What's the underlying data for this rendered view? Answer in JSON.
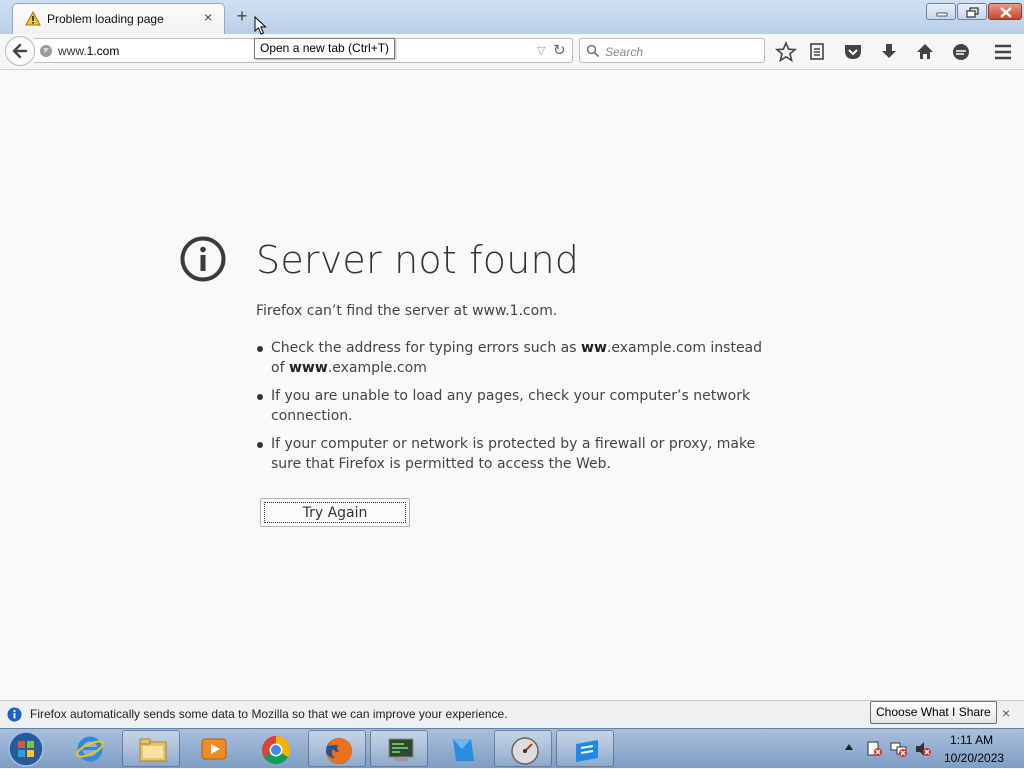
{
  "window": {
    "tab_title": "Problem loading page",
    "tab_close": "×",
    "new_tab": "+",
    "tooltip": "Open a new tab (Ctrl+T)"
  },
  "navbar": {
    "url_prefix": "www.",
    "url_domain": "1.com",
    "search_placeholder": "Search"
  },
  "error_page": {
    "title": "Server not found",
    "description": "Firefox can’t find the server at www.1.com.",
    "tip1_pre": "Check the address for typing errors such as ",
    "tip1_bold1": "ww",
    "tip1_mid": ".example.com instead of ",
    "tip1_bold2": "www",
    "tip1_post": ".example.com",
    "tip2": "If you are unable to load any pages, check your computer’s network connection.",
    "tip3": "If your computer or network is protected by a firewall or proxy, make sure that Firefox is permitted to access the Web.",
    "try_again": "Try Again"
  },
  "notification": {
    "message": "Firefox automatically sends some data to Mozilla so that we can improve your experience.",
    "button": "Choose What I Share",
    "close": "×"
  },
  "taskbar": {
    "items": [
      "internet-explorer-icon",
      "file-explorer-icon",
      "media-player-icon",
      "chrome-icon",
      "firefox-icon",
      "terminal-icon",
      "blue-app-icon",
      "speedometer-icon",
      "blue-window-icon"
    ],
    "time": "1:11 AM",
    "date": "10/20/2023"
  },
  "colors": {
    "title_bar": "#b9cfe8",
    "page_bg": "#f9f9fa",
    "taskbar": "#7f9dc4"
  }
}
